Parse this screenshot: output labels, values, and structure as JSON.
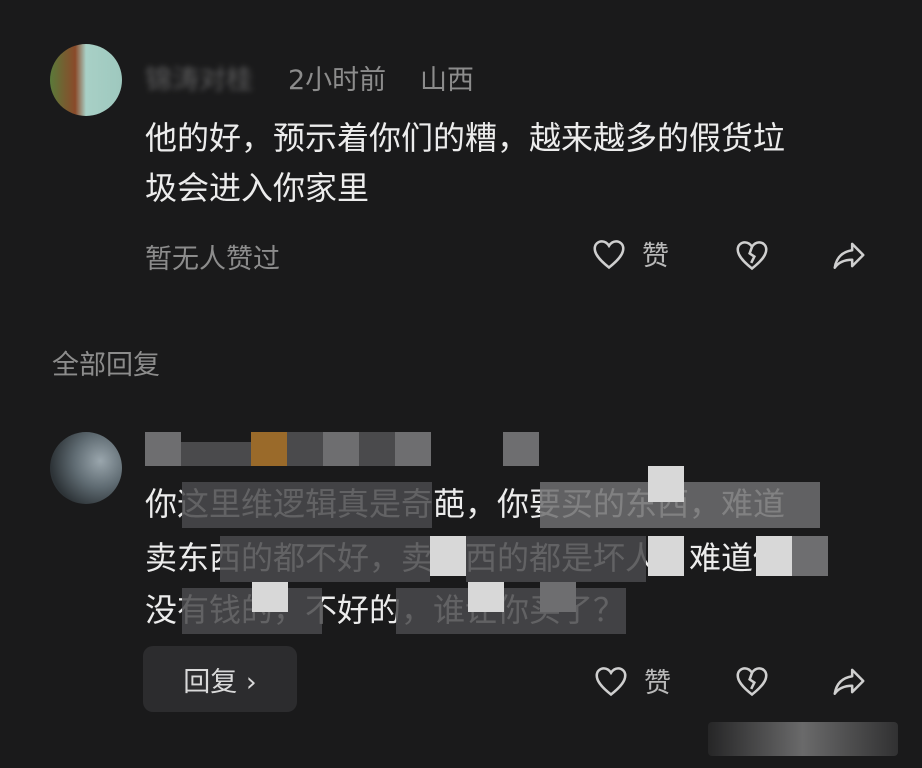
{
  "comment": {
    "username": "锦涛对桂",
    "time": "2小时前",
    "location": "山西",
    "text_line1": "他的好，预示着你们的糟，越来越多的假货垃",
    "text_line2": "圾会进入你家里",
    "likes_status": "暂无人赞过",
    "like_label": "赞"
  },
  "section": {
    "all_replies": "全部回复"
  },
  "reply": {
    "text_line1": "你这里维逻辑真是奇葩，你要买的东西，难道",
    "text_line2": "卖东西的都不好，卖东西的都是坏人？难道你",
    "text_line3": "没有钱的，不好的，谁让你买了？",
    "like_label": "赞",
    "reply_button": "回复 ›"
  },
  "icons": [
    "heart-icon",
    "broken-heart-icon",
    "share-icon"
  ],
  "colors": {
    "background": "#1a1a1b",
    "text": "#ececec",
    "muted": "#8c8c8c",
    "button": "#2c2c2e"
  }
}
